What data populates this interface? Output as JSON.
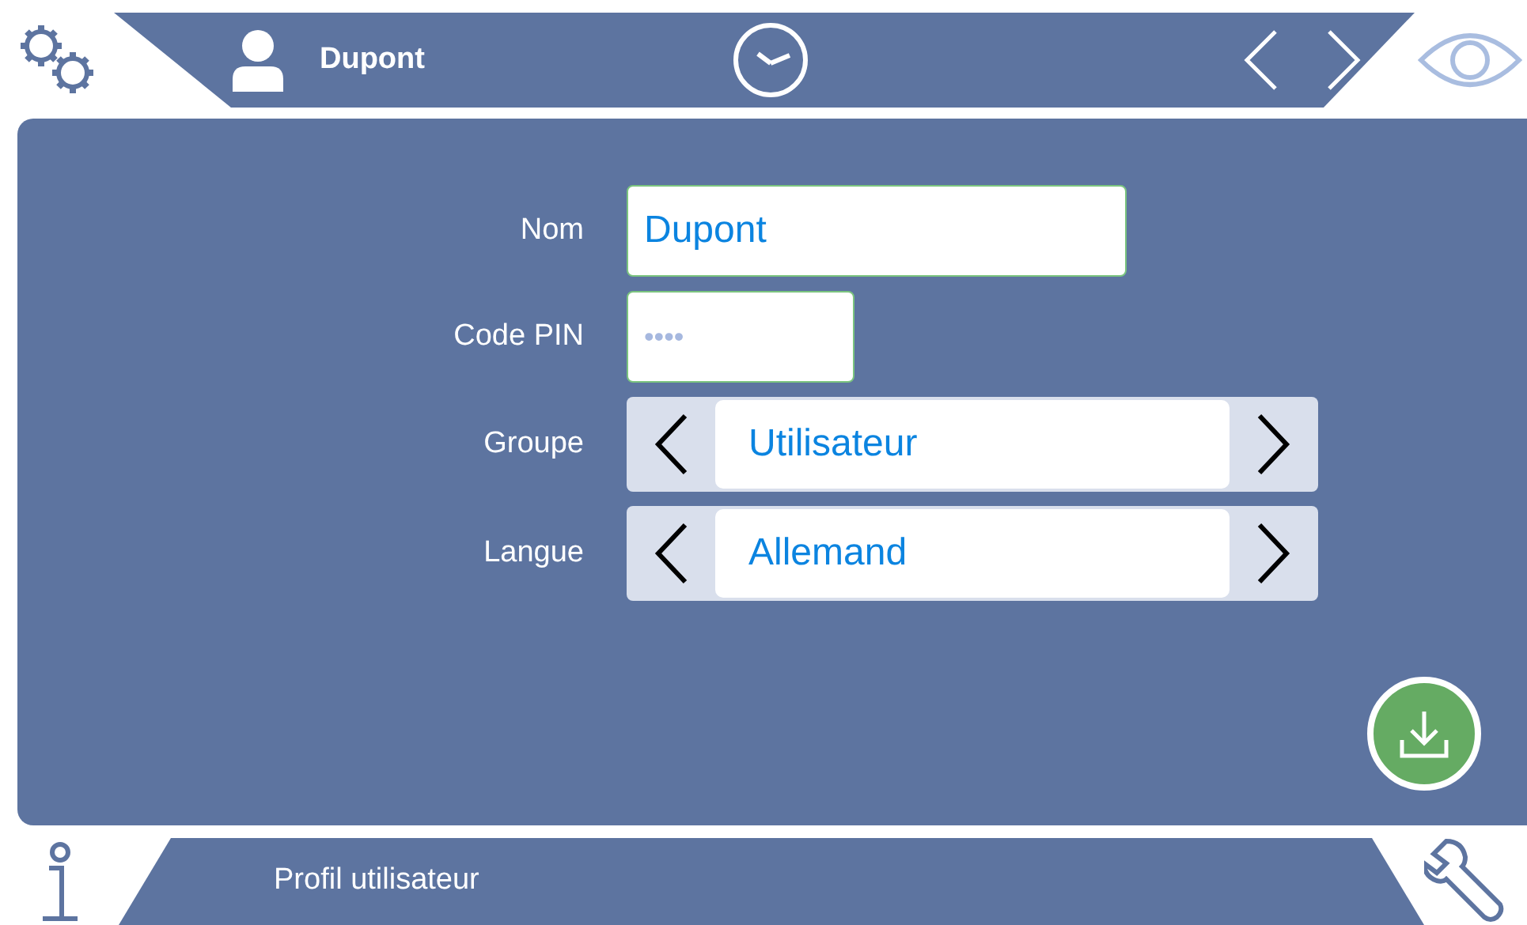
{
  "header": {
    "user": "Dupont"
  },
  "form": {
    "fields": [
      {
        "kind": "text",
        "label": "Nom",
        "value": "Dupont"
      },
      {
        "kind": "pin",
        "label": "Code PIN",
        "value": "••••"
      },
      {
        "kind": "selector",
        "label": "Groupe",
        "value": "Utilisateur"
      },
      {
        "kind": "selector",
        "label": "Langue",
        "value": "Allemand"
      }
    ]
  },
  "footer": {
    "title": "Profil utilisateur"
  }
}
